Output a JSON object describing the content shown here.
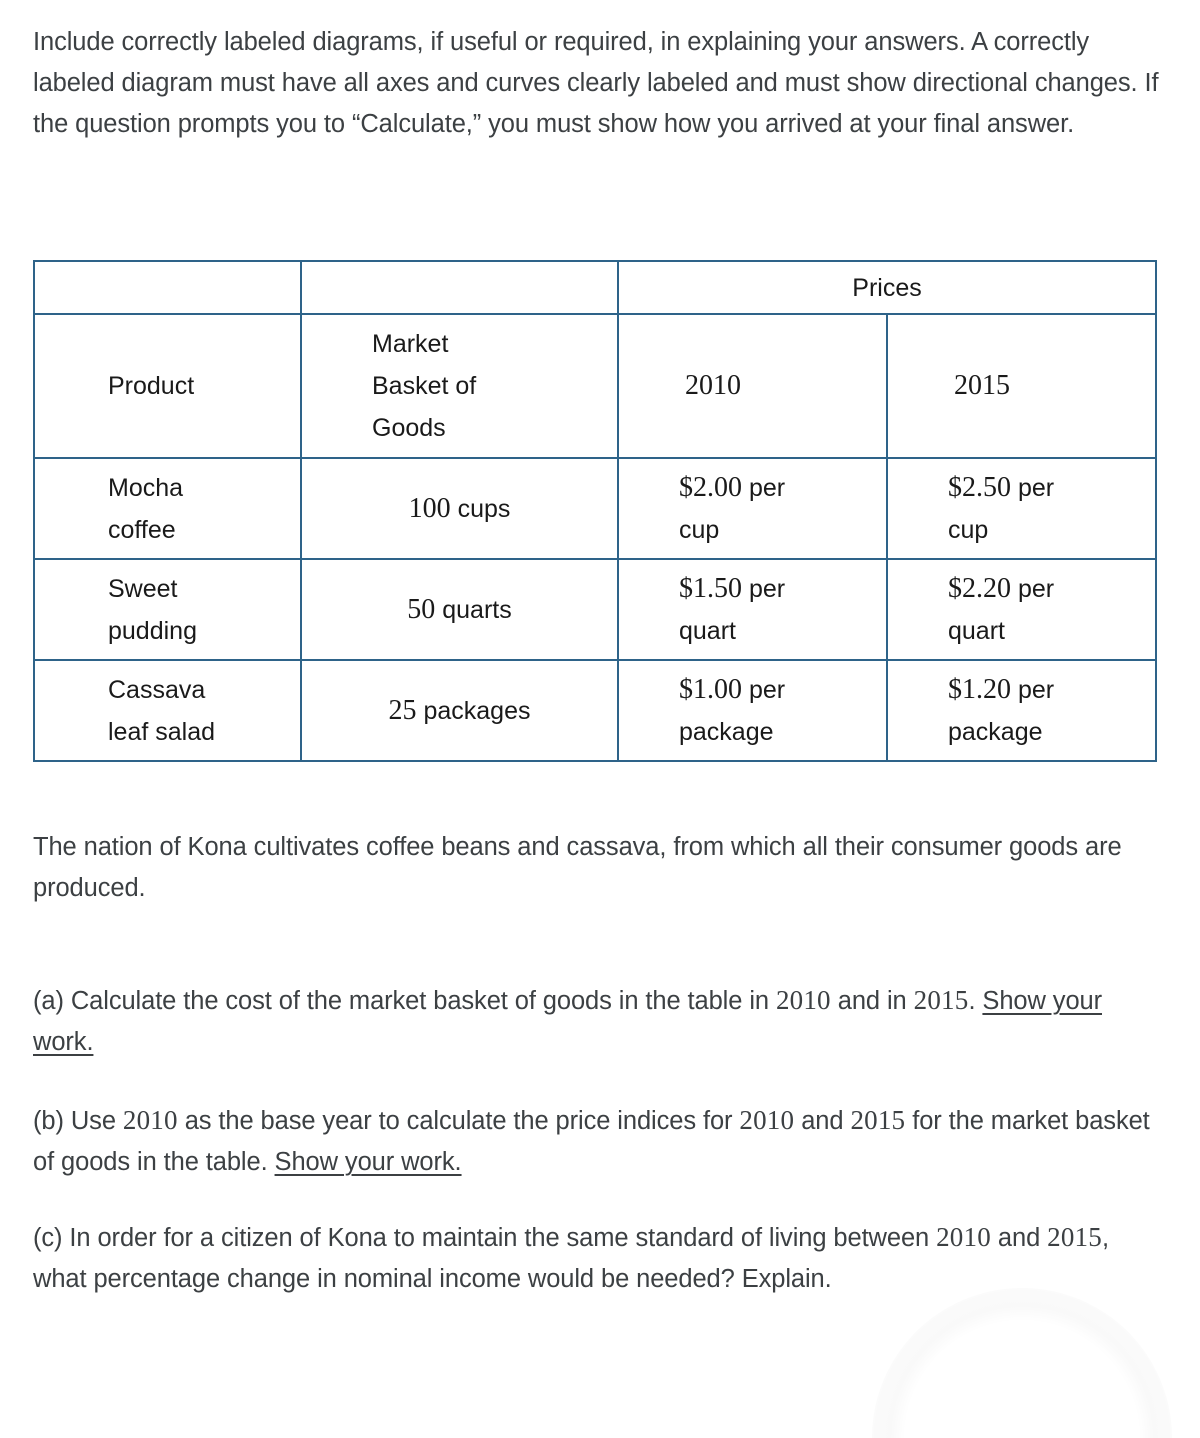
{
  "document": {
    "intro_paragraph": "Include correctly labeled diagrams, if useful or required, in explaining your answers. A correctly labeled diagram must have all axes and curves clearly labeled and must show directional changes. If the question prompts you to “Calculate,” you must show how you arrived at your final answer.",
    "context_paragraph": "The nation of Kona cultivates coffee beans and cassava, from which all their consumer goods are produced.",
    "border_color": "#2e6389",
    "body_text_color": "#3c4043",
    "table_text_color": "#1a1a1a"
  },
  "table": {
    "blank_corner_1": "",
    "blank_corner_2": "",
    "prices_group_header": "Prices",
    "headers": {
      "product": "Product",
      "market_basket": "Market Basket of Goods",
      "market_basket_line1": "Market",
      "market_basket_line2": "Basket of",
      "market_basket_line3": "Goods",
      "year_2010": "2010",
      "year_2015": "2015"
    },
    "rows": [
      {
        "product_line1": "Mocha",
        "product_line2": "coffee",
        "quantity_number": "100",
        "quantity_unit": "cups",
        "price_2010_amount": "$2.00",
        "price_2010_per": "per",
        "price_2010_unit": "cup",
        "price_2015_amount": "$2.50",
        "price_2015_per": "per",
        "price_2015_unit": "cup"
      },
      {
        "product_line1": "Sweet",
        "product_line2": "pudding",
        "quantity_number": "50",
        "quantity_unit": "quarts",
        "price_2010_amount": "$1.50",
        "price_2010_per": "per",
        "price_2010_unit": "quart",
        "price_2015_amount": "$2.20",
        "price_2015_per": "per",
        "price_2015_unit": "quart"
      },
      {
        "product_line1": "Cassava",
        "product_line2": "leaf salad",
        "quantity_number": "25",
        "quantity_unit": "packages",
        "price_2010_amount": "$1.00",
        "price_2010_per": "per",
        "price_2010_unit": "package",
        "price_2015_amount": "$1.20",
        "price_2015_per": "per",
        "price_2015_unit": "package"
      }
    ]
  },
  "questions": {
    "a": {
      "label": "(a)",
      "text_before": " Calculate the cost of the market basket of goods in the table in ",
      "year_1": "2010",
      "text_middle": " and in ",
      "year_2": "2015",
      "text_after": ". ",
      "show_work": "Show your work."
    },
    "b": {
      "label": "(b)",
      "text_before": " Use ",
      "year_1": "2010",
      "text_middle": " as the base year to calculate the price indices for ",
      "year_2": "2010",
      "text_middle_2": " and ",
      "year_3": "2015",
      "text_after": " for the market basket of goods in the table. ",
      "show_work": "Show your work."
    },
    "c": {
      "label": "(c)",
      "text_before": " In order for a citizen of Kona to maintain the same standard of living between ",
      "year_1": "2010",
      "text_middle": " and ",
      "year_2": "2015",
      "text_after": ", what percentage change in nominal income would be needed? Explain."
    }
  }
}
